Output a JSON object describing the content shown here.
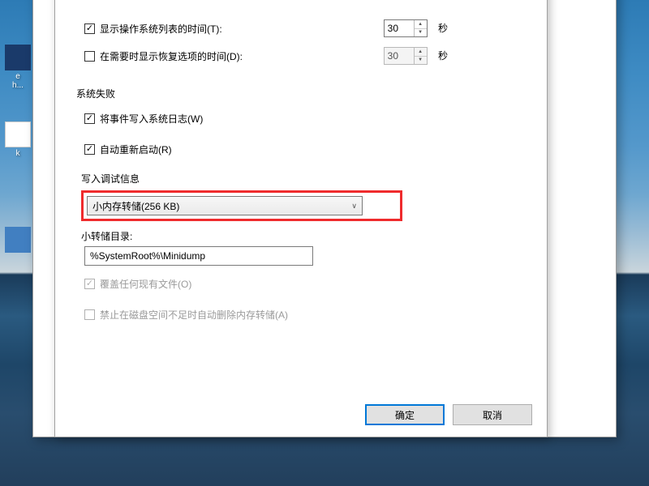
{
  "desktop": {
    "icons": [
      {
        "label": "e"
      },
      {
        "label": "h..."
      },
      {
        "label": "k"
      }
    ]
  },
  "boot": {
    "show_os_list": {
      "label": "显示操作系统列表的时间(T):",
      "value": "30",
      "unit": "秒",
      "checked": true
    },
    "show_recovery": {
      "label": "在需要时显示恢复选项的时间(D):",
      "value": "30",
      "unit": "秒",
      "checked": false
    }
  },
  "system_failure": {
    "title": "系统失败",
    "write_event_log": {
      "label": "将事件写入系统日志(W)",
      "checked": true
    },
    "auto_restart": {
      "label": "自动重新启动(R)",
      "checked": true
    },
    "debug_info_title": "写入调试信息",
    "dump_type": "小内存转储(256 KB)",
    "dump_dir_label": "小转储目录:",
    "dump_dir_value": "%SystemRoot%\\Minidump",
    "overwrite": {
      "label": "覆盖任何现有文件(O)",
      "checked": true
    },
    "disable_auto_delete": {
      "label": "禁止在磁盘空间不足时自动删除内存转储(A)",
      "checked": false
    }
  },
  "buttons": {
    "ok": "确定",
    "cancel": "取消"
  }
}
